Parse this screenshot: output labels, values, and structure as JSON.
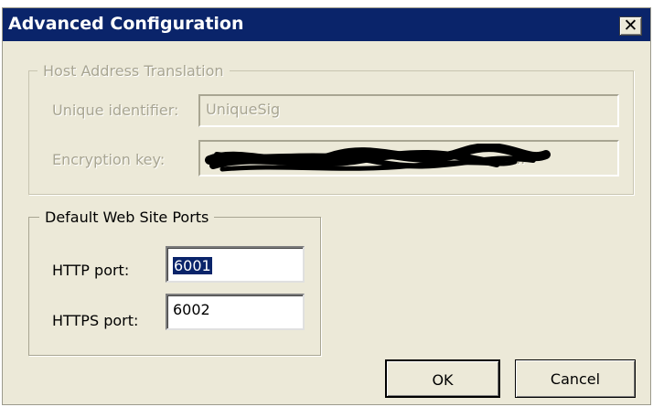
{
  "dialog": {
    "title": "Advanced Configuration",
    "close_glyph": "✕"
  },
  "host_group": {
    "legend": "Host Address Translation",
    "unique_id_label": "Unique identifier:",
    "unique_id_value": "UniqueSig",
    "encryption_key_label": "Encryption key:",
    "encryption_key_value": "",
    "encryption_key_visible_tail": "..."
  },
  "ports_group": {
    "legend": "Default Web Site Ports",
    "http_label": "HTTP port:",
    "http_value": "6001",
    "https_label": "HTTPS port:",
    "https_value": "6002"
  },
  "buttons": {
    "ok_label": "OK",
    "cancel_label": "Cancel"
  },
  "colors": {
    "title_bar": "#0a246a",
    "dialog_bg": "#ece9d8",
    "disabled_text": "#a8a592",
    "selection": "#0a246a"
  }
}
